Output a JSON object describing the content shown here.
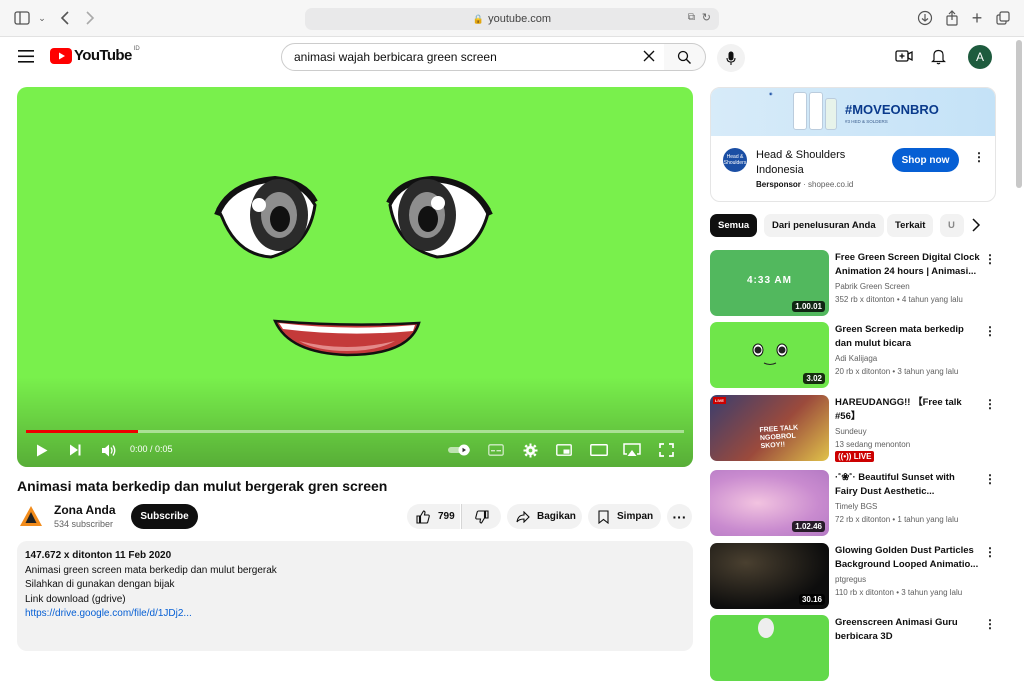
{
  "browser": {
    "url": "youtube.com"
  },
  "header": {
    "logo_text": "YouTube",
    "region": "ID",
    "search_value": "animasi wajah berbicara green screen",
    "avatar_letter": "A"
  },
  "player": {
    "time": "0:00 / 0:05",
    "progress": 0.17
  },
  "video": {
    "title": "Animasi mata berkedip dan mulut bergerak gren screen",
    "channel": "Zona Anda",
    "subscribers": "534 subscriber",
    "subscribe_label": "Subscribe",
    "likes": "799",
    "share_label": "Bagikan",
    "save_label": "Simpan"
  },
  "description": {
    "meta": "147.672 x ditonton  11 Feb 2020",
    "lines": [
      "Animasi green screen mata berkedip dan mulut bergerak",
      "Silahkan di gunakan dengan bijak",
      "Link download (gdrive)"
    ],
    "link": "https://drive.google.com/file/d/1JDj2..."
  },
  "ad": {
    "banner_text": "#MOVEONBRO",
    "banner_sub": "#3 HED & SOLDERS",
    "logo_text": "Head & Shoulders",
    "title": "Head & Shoulders Indonesia",
    "sponsored": "Bersponsor",
    "domain": "shopee.co.id",
    "cta": "Shop now"
  },
  "chips": [
    "Semua",
    "Dari penelusuran Anda",
    "Terkait",
    "U"
  ],
  "recommendations": [
    {
      "title": "Free Green Screen Digital Clock Animation 24 hours | Animasi...",
      "channel": "Pabrik Green Screen",
      "meta": "352 rb x ditonton  • 4 tahun yang lalu",
      "duration": "1.00.01",
      "thumb_text": "4:33 AM"
    },
    {
      "title": "Green Screen mata berkedip dan mulut bicara",
      "channel": "Adi Kalijaga",
      "meta": "20 rb x ditonton  • 3 tahun yang lalu",
      "duration": "3.02"
    },
    {
      "title": "HAREUDANGG!! 【Free talk #56】",
      "channel": "Sundeuy",
      "meta": "13 sedang menonton",
      "live": "LIVE",
      "thumb_text": "FREE TALK NGOBROL SKOY!!",
      "thumb_badge": "LIVE"
    },
    {
      "title": "·˚❀˚· Beautiful Sunset with Fairy Dust Aesthetic...",
      "channel": "Timely BGS",
      "meta": "72 rb x ditonton  • 1 tahun yang lalu",
      "duration": "1.02.46"
    },
    {
      "title": "Glowing Golden Dust Particles Background Looped Animatio...",
      "channel": "ptgregus",
      "meta": "110 rb x ditonton  • 3 tahun yang lalu",
      "duration": "30.16"
    },
    {
      "title": "Greenscreen Animasi Guru berbicara 3D",
      "channel": "",
      "meta": ""
    }
  ]
}
